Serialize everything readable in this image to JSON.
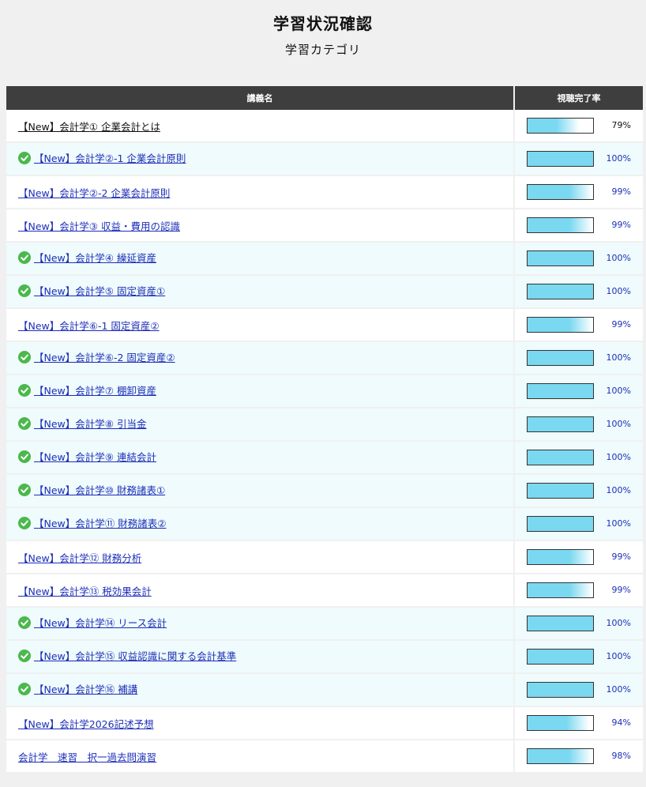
{
  "header": {
    "title": "学習状況確認",
    "subtitle": "学習カテゴリ"
  },
  "table": {
    "col_name": "講義名",
    "col_rate": "視聴完了率"
  },
  "colors": {
    "header_bg": "#3e3e3e",
    "bar_fill": "#7ad8f0",
    "check": "#4bb84b",
    "link": "#1c2fb8",
    "completed_row_bg": "#effbfc"
  },
  "lectures": [
    {
      "title": "【New】会計学① 企業会計とは",
      "rate": "79%",
      "progress": 0.79,
      "completed": false
    },
    {
      "title": "【New】会計学②-1 企業会計原則",
      "rate": "100%",
      "progress": 1.0,
      "completed": true
    },
    {
      "title": "【New】会計学②-2 企業会計原則",
      "rate": "99%",
      "progress": 0.99,
      "completed": false
    },
    {
      "title": "【New】会計学③ 収益・費用の認識",
      "rate": "99%",
      "progress": 0.99,
      "completed": false
    },
    {
      "title": "【New】会計学④ 繰延資産",
      "rate": "100%",
      "progress": 1.0,
      "completed": true
    },
    {
      "title": "【New】会計学⑤ 固定資産①",
      "rate": "100%",
      "progress": 1.0,
      "completed": true
    },
    {
      "title": "【New】会計学⑥-1 固定資産②",
      "rate": "99%",
      "progress": 0.99,
      "completed": false
    },
    {
      "title": "【New】会計学⑥-2 固定資産②",
      "rate": "100%",
      "progress": 1.0,
      "completed": true
    },
    {
      "title": "【New】会計学⑦ 棚卸資産",
      "rate": "100%",
      "progress": 1.0,
      "completed": true
    },
    {
      "title": "【New】会計学⑧ 引当金",
      "rate": "100%",
      "progress": 1.0,
      "completed": true
    },
    {
      "title": "【New】会計学⑨ 連結会計",
      "rate": "100%",
      "progress": 1.0,
      "completed": true
    },
    {
      "title": "【New】会計学⑩ 財務諸表①",
      "rate": "100%",
      "progress": 1.0,
      "completed": true
    },
    {
      "title": "【New】会計学⑪ 財務諸表②",
      "rate": "100%",
      "progress": 1.0,
      "completed": true
    },
    {
      "title": "【New】会計学⑫ 財務分析",
      "rate": "99%",
      "progress": 0.99,
      "completed": false
    },
    {
      "title": "【New】会計学⑬ 税効果会計",
      "rate": "99%",
      "progress": 0.99,
      "completed": false
    },
    {
      "title": "【New】会計学⑭ リース会計",
      "rate": "100%",
      "progress": 1.0,
      "completed": true
    },
    {
      "title": "【New】会計学⑮ 収益認識に関する会計基準",
      "rate": "100%",
      "progress": 1.0,
      "completed": true
    },
    {
      "title": "【New】会計学⑯ 補講",
      "rate": "100%",
      "progress": 1.0,
      "completed": true
    },
    {
      "title": "【New】会計学2026記述予想",
      "rate": "94%",
      "progress": 0.94,
      "completed": false
    },
    {
      "title": "会計学　速習　択一過去問演習",
      "rate": "98%",
      "progress": 0.98,
      "completed": false
    }
  ]
}
